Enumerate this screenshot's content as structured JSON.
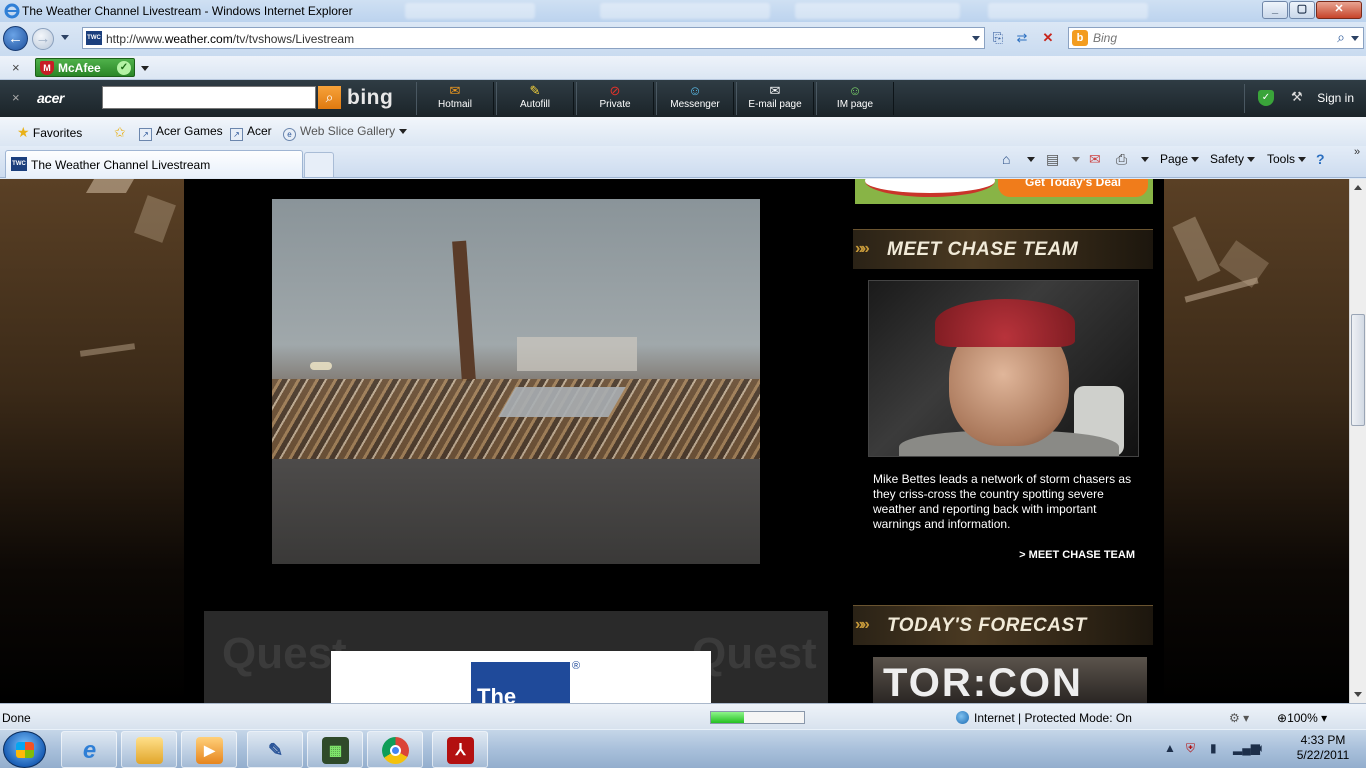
{
  "window": {
    "title": "The Weather Channel Livestream - Windows Internet Explorer"
  },
  "address_bar": {
    "url_prefix": "http://www.",
    "url_domain": "weather.com",
    "url_path": "/tv/tvshows/Livestream"
  },
  "search_box": {
    "placeholder": "Bing"
  },
  "mcafee": {
    "label": "McAfee"
  },
  "acer_toolbar": {
    "logo": "acer",
    "bing_label": "bing",
    "buttons": [
      "Hotmail",
      "Autofill",
      "Private",
      "Messenger",
      "E-mail page",
      "IM page"
    ],
    "sign_in": "Sign in"
  },
  "favorites_bar": {
    "favorites": "Favorites",
    "items": [
      "Acer Games",
      "Acer",
      "Web Slice Gallery"
    ]
  },
  "tab": {
    "title": "The Weather Channel Livestream",
    "favicon_text": "TWC"
  },
  "command_bar": {
    "page": "Page",
    "safety": "Safety",
    "tools": "Tools"
  },
  "page": {
    "promo_deal": "Get Today's Deal",
    "chase_heading": "MEET CHASE TEAM",
    "chase_description": "Mike Bettes leads a network of storm chasers as they criss-cross the country spotting severe weather and reporting back with important warnings and information.",
    "chase_link": "> MEET CHASE TEAM",
    "forecast_heading": "TODAY'S FORECAST",
    "ad_text": "The",
    "ad_reg": "®",
    "ad_bg_word": "Quest",
    "torcon": "TOR:CON"
  },
  "status_bar": {
    "status": "Done",
    "progress": 0.35,
    "zone": "Internet | Protected Mode: On",
    "zoom": "100%"
  },
  "taskbar": {
    "time": "4:33 PM",
    "date": "5/22/2011"
  },
  "colors": {
    "accent_gold": "#c79a3a",
    "page_bg": "#000000",
    "acer_bar": "#1b2429"
  }
}
